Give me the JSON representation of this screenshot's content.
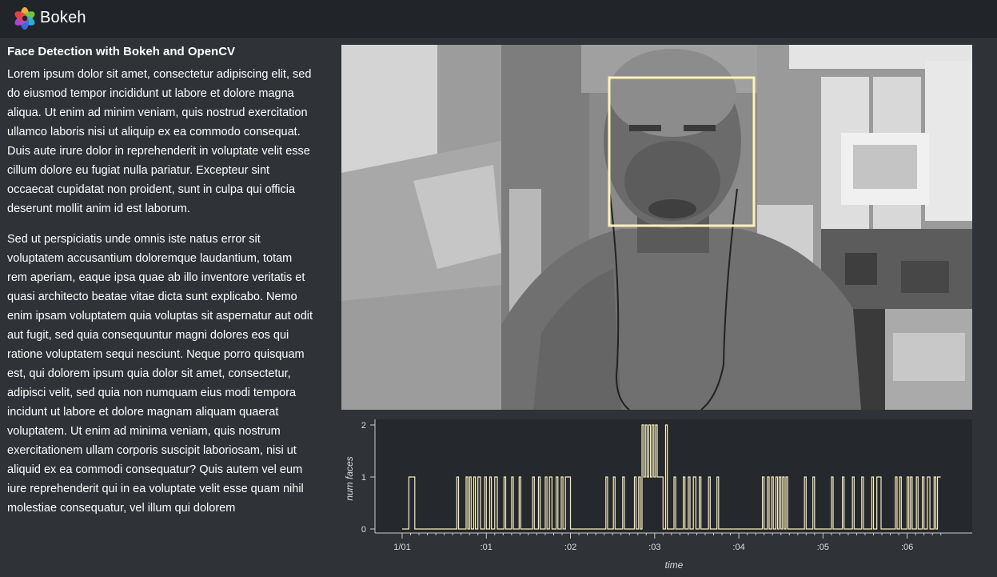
{
  "app": {
    "brand": "Bokeh"
  },
  "sidebar": {
    "title": "Face Detection with Bokeh and OpenCV",
    "paragraphs": [
      "Lorem ipsum dolor sit amet, consectetur adipiscing elit, sed do eiusmod tempor incididunt ut labore et dolore magna aliqua. Ut enim ad minim veniam, quis nostrud exercitation ullamco laboris nisi ut aliquip ex ea commodo consequat. Duis aute irure dolor in reprehenderit in voluptate velit esse cillum dolore eu fugiat nulla pariatur. Excepteur sint occaecat cupidatat non proident, sunt in culpa qui officia deserunt mollit anim id est laborum.",
      "Sed ut perspiciatis unde omnis iste natus error sit voluptatem accusantium doloremque laudantium, totam rem aperiam, eaque ipsa quae ab illo inventore veritatis et quasi architecto beatae vitae dicta sunt explicabo. Nemo enim ipsam voluptatem quia voluptas sit aspernatur aut odit aut fugit, sed quia consequuntur magni dolores eos qui ratione voluptatem sequi nesciunt. Neque porro quisquam est, qui dolorem ipsum quia dolor sit amet, consectetur, adipisci velit, sed quia non numquam eius modi tempora incidunt ut labore et dolore magnam aliquam quaerat voluptatem. Ut enim ad minima veniam, quis nostrum exercitationem ullam corporis suscipit laboriosam, nisi ut aliquid ex ea commodi consequatur? Quis autem vel eum iure reprehenderit qui in ea voluptate velit esse quam nihil molestiae consequatur, vel illum qui dolorem"
    ]
  },
  "colors": {
    "page_bg": "#2f3237",
    "navbar_bg": "#212429",
    "plot_bg": "#25282d",
    "line": "#f7edc0",
    "face_box": "#fff2b8"
  },
  "chart_data": {
    "type": "line",
    "xlabel": "time",
    "ylabel": "num faces",
    "xticks": [
      ":01",
      ":02",
      ":03",
      ":04",
      ":05",
      ":06"
    ],
    "xtick_first": "1/01",
    "yticks": [
      0,
      1,
      2
    ],
    "ylim": [
      0,
      2
    ],
    "x_unit": "seconds",
    "xlim": [
      0,
      64.5
    ],
    "grid": false,
    "steps": [
      [
        0.0,
        0
      ],
      [
        0.8,
        1
      ],
      [
        1.5,
        0
      ],
      [
        6.5,
        1
      ],
      [
        6.7,
        0
      ],
      [
        7.6,
        1
      ],
      [
        7.8,
        0
      ],
      [
        8.0,
        1
      ],
      [
        8.2,
        0
      ],
      [
        8.5,
        1
      ],
      [
        8.7,
        0
      ],
      [
        9.0,
        1
      ],
      [
        9.3,
        0
      ],
      [
        9.8,
        1
      ],
      [
        10.0,
        0
      ],
      [
        10.4,
        1
      ],
      [
        10.6,
        0
      ],
      [
        11.0,
        1
      ],
      [
        11.3,
        0
      ],
      [
        12.1,
        1
      ],
      [
        12.3,
        0
      ],
      [
        13.0,
        1
      ],
      [
        13.2,
        0
      ],
      [
        13.9,
        1
      ],
      [
        14.1,
        0
      ],
      [
        15.5,
        1
      ],
      [
        15.7,
        0
      ],
      [
        16.2,
        1
      ],
      [
        16.4,
        0
      ],
      [
        17.0,
        1
      ],
      [
        17.2,
        0
      ],
      [
        17.5,
        1
      ],
      [
        17.8,
        0
      ],
      [
        18.3,
        1
      ],
      [
        18.5,
        0
      ],
      [
        18.9,
        1
      ],
      [
        19.1,
        0
      ],
      [
        19.4,
        1
      ],
      [
        20.0,
        0
      ],
      [
        24.2,
        1
      ],
      [
        24.4,
        0
      ],
      [
        25.1,
        1
      ],
      [
        25.3,
        0
      ],
      [
        26.2,
        1
      ],
      [
        26.4,
        0
      ],
      [
        27.6,
        1
      ],
      [
        27.8,
        0
      ],
      [
        28.1,
        1
      ],
      [
        28.3,
        0
      ],
      [
        28.5,
        2
      ],
      [
        28.7,
        1
      ],
      [
        28.9,
        2
      ],
      [
        29.1,
        1
      ],
      [
        29.3,
        2
      ],
      [
        29.5,
        1
      ],
      [
        29.7,
        2
      ],
      [
        29.9,
        1
      ],
      [
        30.1,
        2
      ],
      [
        30.3,
        1
      ],
      [
        31.0,
        0
      ],
      [
        31.3,
        2
      ],
      [
        31.5,
        0
      ],
      [
        32.3,
        1
      ],
      [
        32.5,
        0
      ],
      [
        33.4,
        1
      ],
      [
        33.6,
        0
      ],
      [
        34.0,
        1
      ],
      [
        34.2,
        0
      ],
      [
        34.6,
        1
      ],
      [
        34.9,
        0
      ],
      [
        35.3,
        1
      ],
      [
        35.5,
        0
      ],
      [
        36.4,
        1
      ],
      [
        36.6,
        0
      ],
      [
        37.4,
        1
      ],
      [
        37.6,
        0
      ],
      [
        42.8,
        1
      ],
      [
        43.0,
        0
      ],
      [
        43.4,
        1
      ],
      [
        43.6,
        0
      ],
      [
        43.9,
        1
      ],
      [
        44.1,
        0
      ],
      [
        44.4,
        1
      ],
      [
        44.6,
        0
      ],
      [
        44.8,
        1
      ],
      [
        45.0,
        0
      ],
      [
        45.2,
        1
      ],
      [
        45.4,
        0
      ],
      [
        45.6,
        1
      ],
      [
        45.8,
        0
      ],
      [
        47.8,
        1
      ],
      [
        48.0,
        0
      ],
      [
        48.8,
        1
      ],
      [
        49.0,
        0
      ],
      [
        51.0,
        1
      ],
      [
        51.2,
        0
      ],
      [
        52.3,
        1
      ],
      [
        52.5,
        0
      ],
      [
        53.5,
        1
      ],
      [
        53.7,
        0
      ],
      [
        54.6,
        1
      ],
      [
        54.8,
        0
      ],
      [
        55.8,
        1
      ],
      [
        56.0,
        0
      ],
      [
        56.4,
        1
      ],
      [
        56.9,
        0
      ],
      [
        58.6,
        1
      ],
      [
        58.8,
        0
      ],
      [
        59.1,
        1
      ],
      [
        59.3,
        0
      ],
      [
        60.0,
        1
      ],
      [
        60.2,
        0
      ],
      [
        60.4,
        1
      ],
      [
        60.6,
        0
      ],
      [
        61.1,
        1
      ],
      [
        61.3,
        0
      ],
      [
        61.8,
        1
      ],
      [
        62.0,
        0
      ],
      [
        62.4,
        1
      ],
      [
        62.7,
        0
      ],
      [
        63.2,
        1
      ],
      [
        63.4,
        0
      ],
      [
        63.6,
        1
      ],
      [
        64.0,
        1
      ]
    ]
  }
}
